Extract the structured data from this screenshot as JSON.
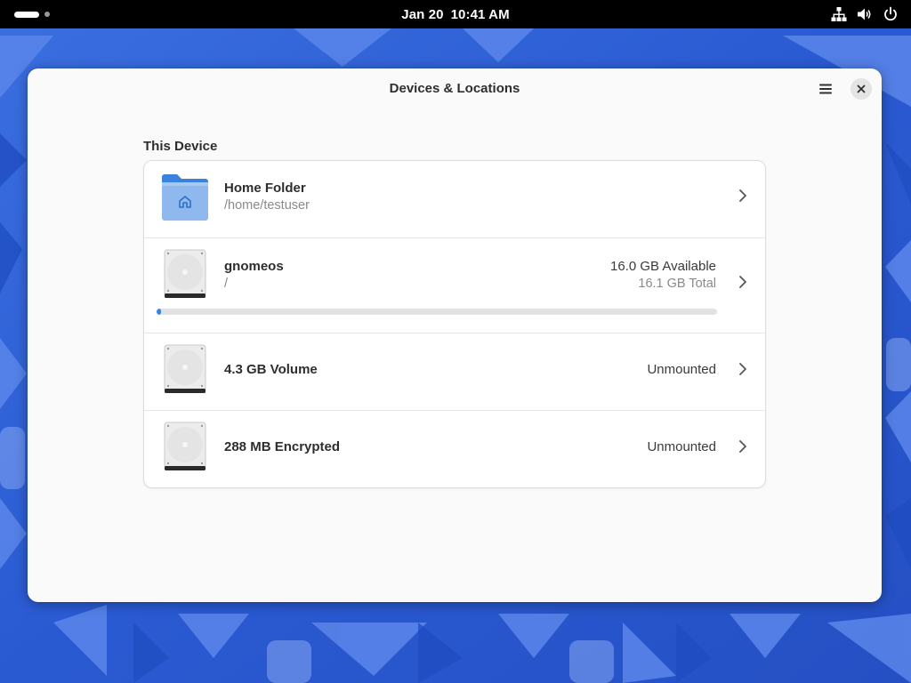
{
  "topbar": {
    "date": "Jan 20",
    "time": "10:41 AM",
    "icons": [
      "network-wired-icon",
      "volume-icon",
      "power-icon"
    ]
  },
  "window": {
    "title": "Devices & Locations"
  },
  "section": {
    "heading": "This Device"
  },
  "devices": [
    {
      "name": "Home Folder",
      "subtitle": "/home/testuser",
      "icon": "home-folder-icon"
    },
    {
      "name": "gnomeos",
      "subtitle": "/",
      "available": "16.0 GB Available",
      "total": "16.1 GB Total",
      "usage_fraction": 0.006,
      "icon": "harddisk-icon"
    },
    {
      "name": "4.3 GB Volume",
      "status": "Unmounted",
      "icon": "harddisk-icon"
    },
    {
      "name": "288 MB Encrypted",
      "status": "Unmounted",
      "icon": "harddisk-icon"
    }
  ],
  "colors": {
    "accent": "#3584e4",
    "window_bg": "#fafafa",
    "topbar_bg": "#000000"
  }
}
